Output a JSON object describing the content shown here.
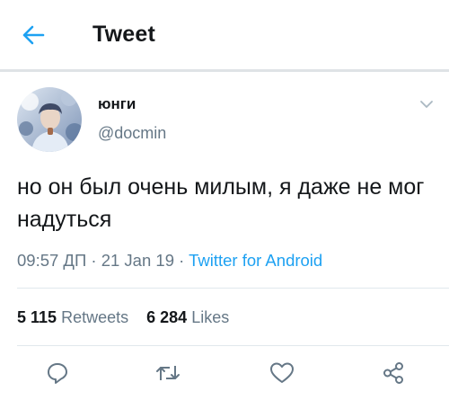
{
  "header": {
    "title": "Tweet",
    "back_icon": "arrow-left-icon"
  },
  "tweet": {
    "author_name": "юнги",
    "author_handle": "@docmin",
    "text": "но он был очень милым, я даже не мог надуться",
    "time": "09:57 ДП",
    "date": "21 Jan 19",
    "source": "Twitter for Android",
    "separator": "·"
  },
  "stats": {
    "retweets_count": "5 115",
    "retweets_label": "Retweets",
    "likes_count": "6 284",
    "likes_label": "Likes"
  },
  "actions": [
    "reply-icon",
    "retweet-icon",
    "like-icon",
    "share-icon"
  ],
  "colors": {
    "accent": "#1da1f2",
    "secondary": "#657786",
    "text": "#14171a",
    "divider": "#e1e8ed"
  }
}
